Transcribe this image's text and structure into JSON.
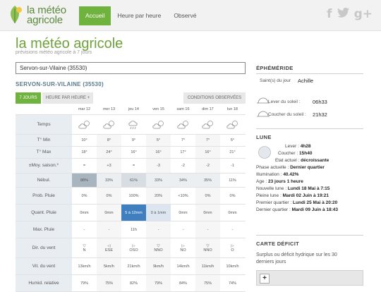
{
  "brand": {
    "line1": "la météo",
    "line2": "agricole",
    "green": "#6fb33e"
  },
  "nav": [
    {
      "label": "Accueil"
    },
    {
      "label": "Heure par heure"
    },
    {
      "label": "Observé"
    }
  ],
  "social": [
    "facebook-icon",
    "twitter-icon",
    "google-plus-icon"
  ],
  "page": {
    "title": "la météo agricole",
    "subtitle": "prévisions météo agricole à 7 jours",
    "city_value": "Servon-sur-Vilaine (35530)",
    "city_heading": "SERVON-SUR-VILAINE (35530)"
  },
  "tabs": {
    "seven_days": "7 JOURS",
    "hourly": "HEURE PAR HEURE +",
    "observed": "CONDITIONS OBSERVÉES"
  },
  "days": [
    "mar 12",
    "mer 13",
    "jeu 14",
    "ven 15",
    "sam 16",
    "dim 17",
    "lun 18"
  ],
  "rows": {
    "temps": "Temps",
    "tmin": {
      "label": "T° Min",
      "values": [
        "10°",
        "8°",
        "9°",
        "5°",
        "7°",
        "7°",
        "5°"
      ]
    },
    "tmax": {
      "label": "T° Max",
      "values": [
        "18°",
        "24°",
        "16°",
        "16°",
        "17°",
        "16°",
        "21°"
      ]
    },
    "moy": {
      "label": "±Moy. saison.*",
      "values": [
        "=",
        "+3",
        "=",
        "-3",
        "-2",
        "-2",
        "-1"
      ]
    },
    "nebul": {
      "label": "Nébul.",
      "values": [
        "88%",
        "33%",
        "61%",
        "33%",
        "34%",
        "35%",
        "11%"
      ]
    },
    "prob": {
      "label": "Prob. Pluie",
      "values": [
        "0%",
        "0%",
        "100%",
        "20%",
        "<10%",
        "0%",
        "0%"
      ]
    },
    "quant": {
      "label": "Quant. Pluie",
      "values": [
        "0mm",
        "0mm",
        "5 à 12mm",
        "0 à 1mm",
        "0mm",
        "0mm",
        "0mm"
      ]
    },
    "max": {
      "label": "Max. Pluie",
      "values": [
        "-",
        "-",
        "11h",
        "-",
        "-",
        "-",
        "-"
      ]
    },
    "dir": {
      "label": "Dir. du vent",
      "values": [
        "N",
        "ESE",
        "OSO",
        "NNO",
        "NO",
        "NNO",
        "O"
      ]
    },
    "vit": {
      "label": "Vit. du vent",
      "values": [
        "13km/h",
        "5km/h",
        "21km/h",
        "9km/h",
        "14km/h",
        "11km/h",
        "10km/h"
      ]
    },
    "humid": {
      "label": "Humid. relative",
      "values": [
        "79%",
        "75%",
        "82%",
        "79%",
        "84%",
        "75%",
        "74%"
      ]
    }
  },
  "ephemeride": {
    "title": "ÉPHÉMÉRIDE",
    "saint_label": "Saint(s) du jour",
    "saint_value": "Achille",
    "sunrise_label": "Lever du soleil :",
    "sunrise_value": "06h33",
    "sunset_label": "Coucher du soleil :",
    "sunset_value": "21h32"
  },
  "lune": {
    "title": "LUNE",
    "lever_label": "Lever :",
    "lever_value": "4h28",
    "coucher_label": "Coucher :",
    "coucher_value": "15h40",
    "etat_label": "Etat actuel :",
    "etat_value": "décroissante",
    "phase_label": "Phase actuelle :",
    "phase_value": "Dernier quartier",
    "illum_label": "Illumination :",
    "illum_value": "40.42%",
    "age_label": "Age :",
    "age_value": "23 jours 1 heure",
    "nl_label": "Nouvelle lune :",
    "nl_value": "Lundi 18 Mai à 7:15",
    "pl_label": "Pleine lune :",
    "pl_value": "Mardi 02 Juin à 19:21",
    "pq_label": "Premier quartier :",
    "pq_value": "Lundi 25 Mai à 20:20",
    "dq_label": "Dernier quartier :",
    "dq_value": "Mardi 09 Juin à 18:43"
  },
  "deficit": {
    "title": "CARTE DÉFICIT",
    "text_line1": "Surplus ou déficit hydrique sur les 30",
    "text_line2": "derniers jours",
    "zoom_in": "+"
  }
}
